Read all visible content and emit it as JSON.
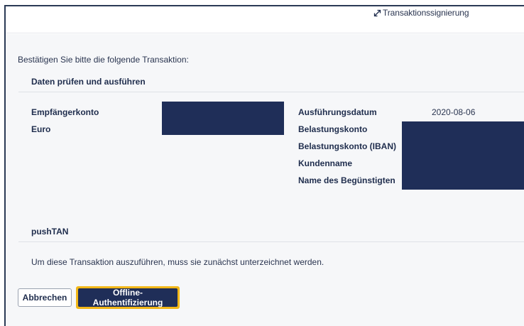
{
  "header": {
    "link_label": "Transaktionssignierung",
    "link_icon": "expand-arrows-icon"
  },
  "intro": "Bestätigen Sie bitte die folgende Transaktion:",
  "sections": {
    "review_title": "Daten prüfen und ausführen",
    "auth_title": "pushTAN"
  },
  "details_left": {
    "recipient_label": "Empfängerkonto",
    "currency_label": "Euro"
  },
  "details_right": {
    "execution_date_label": "Ausführungsdatum",
    "execution_date_value": "2020-08-06",
    "debit_account_label": "Belastungskonto",
    "debit_iban_label": "Belastungskonto (IBAN)",
    "customer_name_label": "Kundenname",
    "beneficiary_name_label": "Name des Begünstigten"
  },
  "note": "Um diese Transaktion auszuführen, muss sie zunächst unterzeichnet werden.",
  "buttons": {
    "cancel": "Abbrechen",
    "offline_auth": "Offline-Authentifizierung"
  },
  "colors": {
    "navy": "#1f2e58",
    "accent_yellow": "#f2b718",
    "panel_bg": "#f6f7f9"
  }
}
